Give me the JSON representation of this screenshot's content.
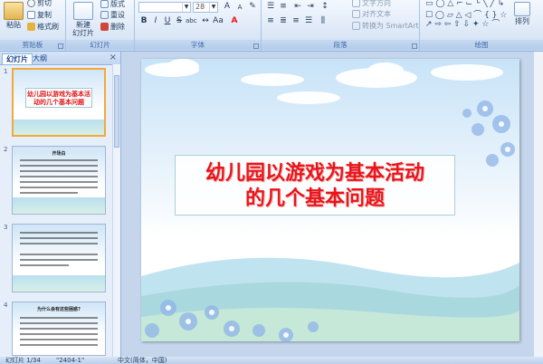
{
  "ribbon": {
    "clipboard": {
      "paste": "粘贴",
      "cut": "剪切",
      "copy": "复制",
      "format_painter": "格式刷",
      "group": "剪贴板"
    },
    "slides": {
      "new_slide": "新建",
      "new_slide_2": "幻灯片",
      "layout": "版式",
      "reset": "重设",
      "delete": "删除",
      "group": "幻灯片"
    },
    "font": {
      "font_name": "",
      "font_size": "28",
      "group": "字体"
    },
    "paragraph": {
      "text_direction": "文字方向",
      "align_text": "对齐文本",
      "smartart": "转换为 SmartArt",
      "group": "段落"
    },
    "drawing": {
      "arrange": "排列",
      "group": "绘图"
    }
  },
  "pane": {
    "tab_slides": "幻灯片",
    "tab_outline": "大纲",
    "close": "×",
    "thumbs": [
      {
        "num": "1",
        "title": "幼儿园以游戏为基本活动的几个基本问题"
      },
      {
        "num": "2",
        "title": "开场白"
      },
      {
        "num": "3",
        "title": ""
      },
      {
        "num": "4",
        "title": "为什么会有这些困惑?"
      }
    ]
  },
  "slide": {
    "title_line1": "幼儿园以游戏为基本活动",
    "title_line2": "的几个基本问题"
  },
  "status": {
    "slide_info": "幻灯片 1/34",
    "theme": "\"2404-1\"",
    "language": "中文(简体，中国)"
  },
  "colors": {
    "title_red": "#e8161b",
    "ribbon_blue": "#dbe7f6",
    "selection": "#f2a93b"
  }
}
